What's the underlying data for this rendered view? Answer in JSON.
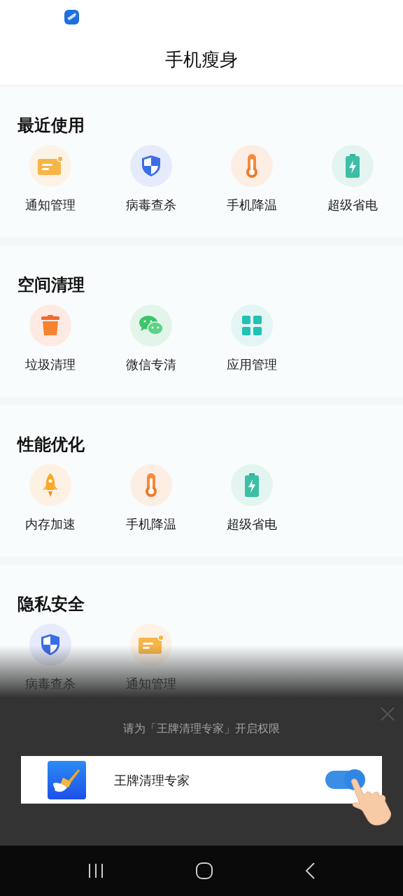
{
  "header": {
    "title": "手机瘦身"
  },
  "sections": [
    {
      "title": "最近使用",
      "items": [
        {
          "label": "通知管理",
          "kind": "notice"
        },
        {
          "label": "病毒查杀",
          "kind": "shield"
        },
        {
          "label": "手机降温",
          "kind": "thermo"
        },
        {
          "label": "超级省电",
          "kind": "battery"
        }
      ]
    },
    {
      "title": "空间清理",
      "items": [
        {
          "label": "垃圾清理",
          "kind": "trash"
        },
        {
          "label": "微信专清",
          "kind": "wechat"
        },
        {
          "label": "应用管理",
          "kind": "grid"
        }
      ]
    },
    {
      "title": "性能优化",
      "items": [
        {
          "label": "内存加速",
          "kind": "rocket"
        },
        {
          "label": "手机降温",
          "kind": "thermo"
        },
        {
          "label": "超级省电",
          "kind": "battery"
        }
      ]
    },
    {
      "title": "隐私安全",
      "items": [
        {
          "label": "病毒查杀",
          "kind": "shield"
        },
        {
          "label": "通知管理",
          "kind": "notice"
        }
      ]
    }
  ],
  "permission_panel": {
    "message": "请为「王牌清理专家」开启权限",
    "app_name": "王牌清理专家",
    "on": true
  }
}
